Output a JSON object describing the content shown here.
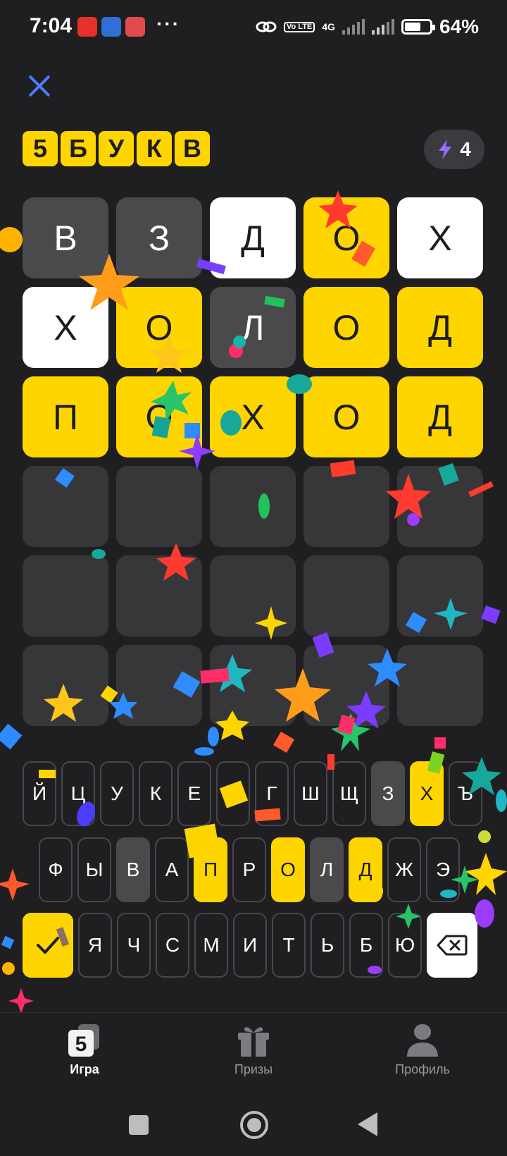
{
  "status_bar": {
    "time": "7:04",
    "dots": "···",
    "network": "4G",
    "volte": "Vo LTE",
    "battery_text": "64%",
    "battery_level": 0.64
  },
  "header": {
    "logo_letters": [
      "5",
      "Б",
      "У",
      "К",
      "В"
    ],
    "hints_count": "4",
    "accent_color": "#ffd500",
    "close_color": "#4b7bff"
  },
  "board": {
    "rows": [
      [
        {
          "letter": "В",
          "state": "gray"
        },
        {
          "letter": "З",
          "state": "gray"
        },
        {
          "letter": "Д",
          "state": "white"
        },
        {
          "letter": "О",
          "state": "yellow"
        },
        {
          "letter": "Х",
          "state": "white"
        }
      ],
      [
        {
          "letter": "Х",
          "state": "white"
        },
        {
          "letter": "О",
          "state": "yellow"
        },
        {
          "letter": "Л",
          "state": "gray"
        },
        {
          "letter": "О",
          "state": "yellow"
        },
        {
          "letter": "Д",
          "state": "yellow"
        }
      ],
      [
        {
          "letter": "П",
          "state": "yellow"
        },
        {
          "letter": "О",
          "state": "yellow"
        },
        {
          "letter": "Х",
          "state": "yellow"
        },
        {
          "letter": "О",
          "state": "yellow"
        },
        {
          "letter": "Д",
          "state": "yellow"
        }
      ],
      [
        {
          "letter": "",
          "state": "empty"
        },
        {
          "letter": "",
          "state": "empty"
        },
        {
          "letter": "",
          "state": "empty"
        },
        {
          "letter": "",
          "state": "empty"
        },
        {
          "letter": "",
          "state": "empty"
        }
      ],
      [
        {
          "letter": "",
          "state": "empty"
        },
        {
          "letter": "",
          "state": "empty"
        },
        {
          "letter": "",
          "state": "empty"
        },
        {
          "letter": "",
          "state": "empty"
        },
        {
          "letter": "",
          "state": "empty"
        }
      ],
      [
        {
          "letter": "",
          "state": "empty"
        },
        {
          "letter": "",
          "state": "empty"
        },
        {
          "letter": "",
          "state": "empty"
        },
        {
          "letter": "",
          "state": "empty"
        },
        {
          "letter": "",
          "state": "empty"
        }
      ]
    ]
  },
  "keyboard": {
    "row1": [
      {
        "k": "Й",
        "s": "none"
      },
      {
        "k": "Ц",
        "s": "none"
      },
      {
        "k": "У",
        "s": "none"
      },
      {
        "k": "К",
        "s": "none"
      },
      {
        "k": "Е",
        "s": "none"
      },
      {
        "k": "Н",
        "s": "none"
      },
      {
        "k": "Г",
        "s": "none"
      },
      {
        "k": "Ш",
        "s": "none"
      },
      {
        "k": "Щ",
        "s": "none"
      },
      {
        "k": "З",
        "s": "gray"
      },
      {
        "k": "Х",
        "s": "yellow"
      },
      {
        "k": "Ъ",
        "s": "none"
      }
    ],
    "row2": [
      {
        "k": "Ф",
        "s": "none"
      },
      {
        "k": "Ы",
        "s": "none"
      },
      {
        "k": "В",
        "s": "gray"
      },
      {
        "k": "А",
        "s": "none"
      },
      {
        "k": "П",
        "s": "yellow"
      },
      {
        "k": "Р",
        "s": "none"
      },
      {
        "k": "О",
        "s": "yellow"
      },
      {
        "k": "Л",
        "s": "gray"
      },
      {
        "k": "Д",
        "s": "yellow"
      },
      {
        "k": "Ж",
        "s": "none"
      },
      {
        "k": "Э",
        "s": "none"
      }
    ],
    "row3": [
      {
        "k": "Я",
        "s": "none"
      },
      {
        "k": "Ч",
        "s": "none"
      },
      {
        "k": "С",
        "s": "none"
      },
      {
        "k": "М",
        "s": "none"
      },
      {
        "k": "И",
        "s": "none"
      },
      {
        "k": "Т",
        "s": "none"
      },
      {
        "k": "Ь",
        "s": "none"
      },
      {
        "k": "Б",
        "s": "none"
      },
      {
        "k": "Ю",
        "s": "none"
      }
    ]
  },
  "bottom_nav": {
    "game_label": "Игра",
    "game_icon_text": "5",
    "prizes_label": "Призы",
    "profile_label": "Профиль"
  }
}
